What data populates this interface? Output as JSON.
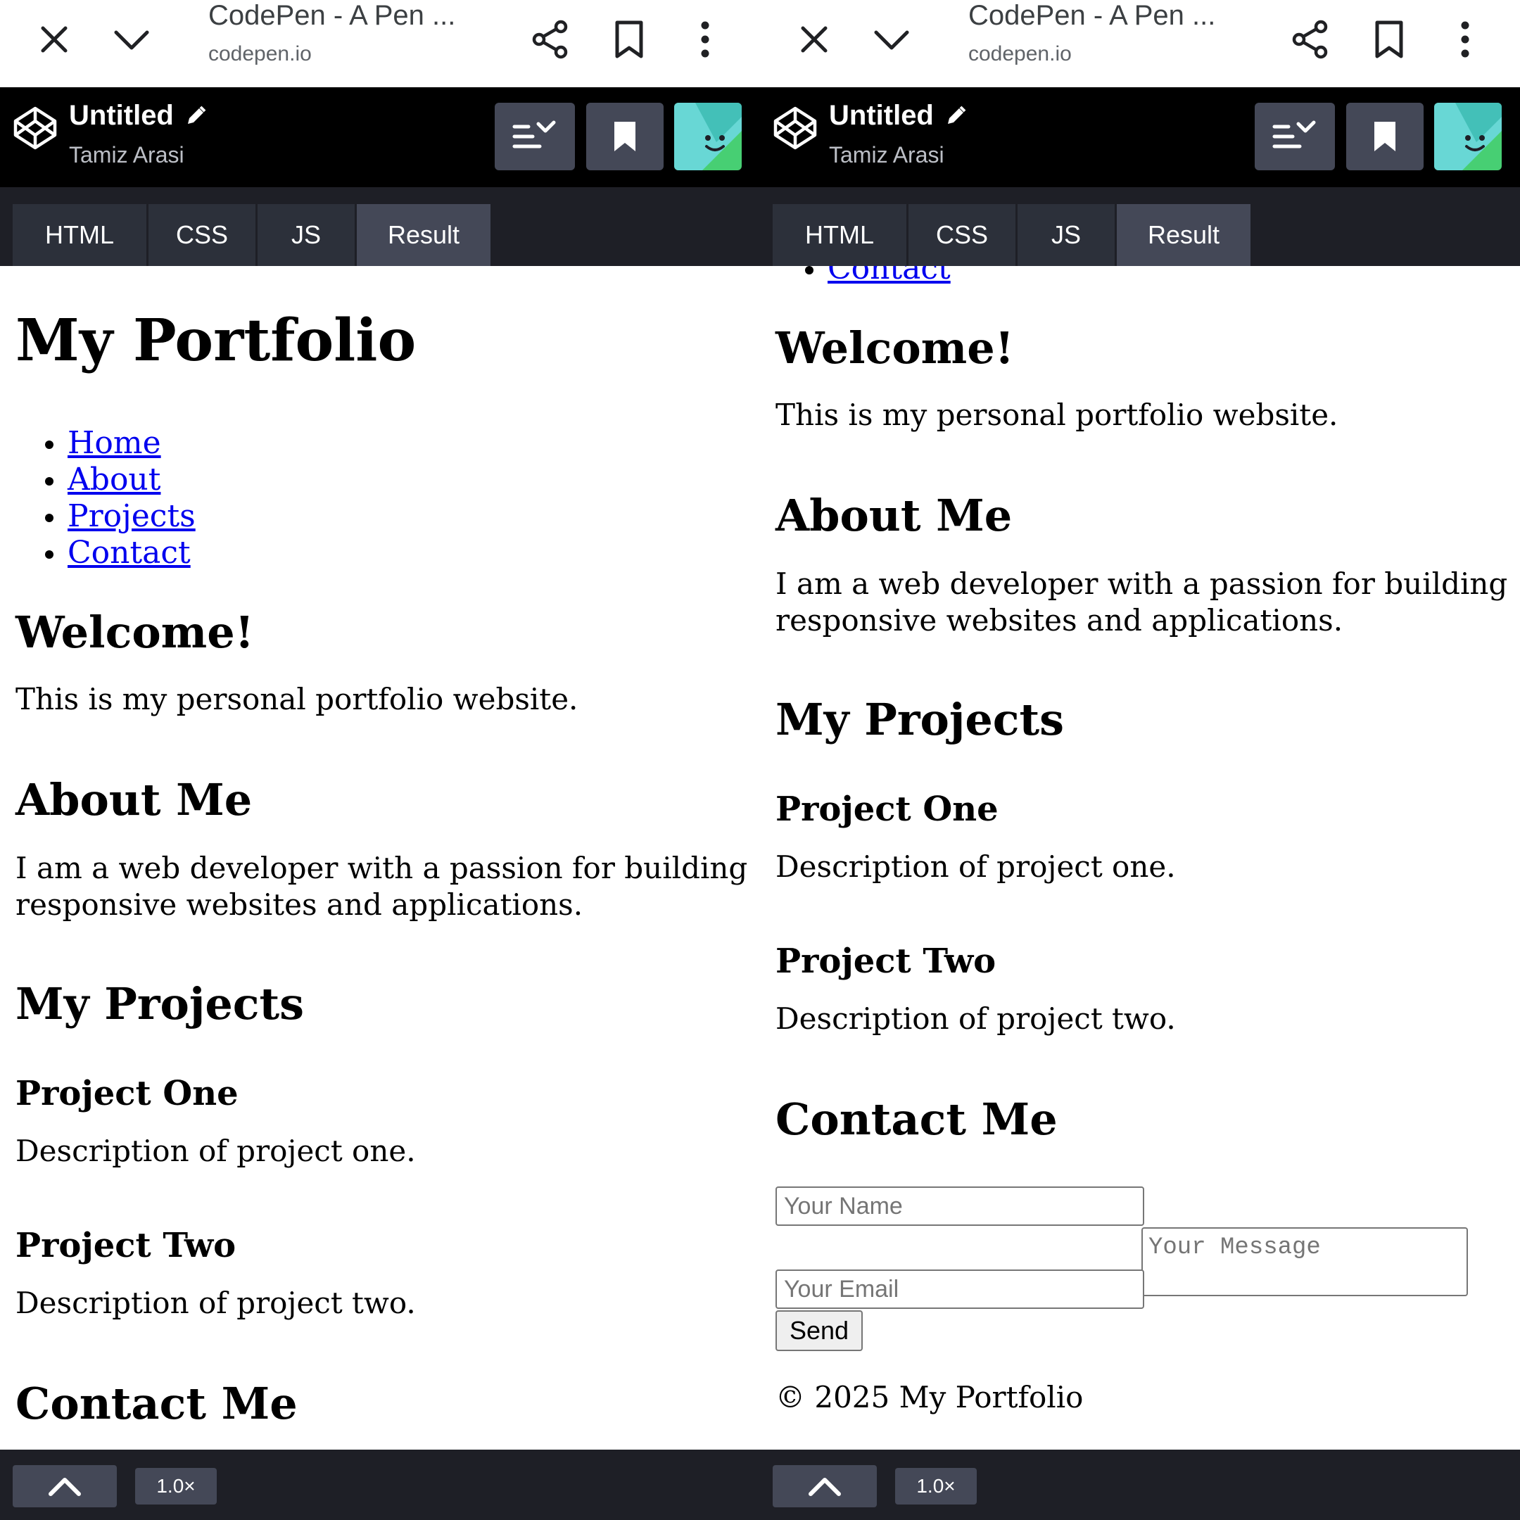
{
  "browser": {
    "title": "CodePen - A Pen ...",
    "url": "codepen.io",
    "icons": [
      "close-icon",
      "chevron-down-icon",
      "share-icon",
      "bookmark-icon",
      "more-vert-icon"
    ]
  },
  "codepen": {
    "pen_title": "Untitled",
    "author": "Tamiz Arasi",
    "tabs": [
      "HTML",
      "CSS",
      "JS",
      "Result"
    ],
    "active_tab": "Result",
    "zoom": "1.0×",
    "colors": {
      "header_bg": "#000000",
      "toolbar_bg": "#1e1f26",
      "button_bg": "#444857",
      "tab_bg": "#2c303a",
      "avatar_accent": "#47cf73"
    }
  },
  "page": {
    "title": "My Portfolio",
    "nav": [
      "Home",
      "About",
      "Projects",
      "Contact"
    ],
    "welcome": {
      "heading": "Welcome!",
      "text": "This is my personal portfolio website."
    },
    "about": {
      "heading": "About Me",
      "line1": "I am a web developer with a passion for building",
      "line2": "responsive websites and applications."
    },
    "projects": {
      "heading": "My Projects",
      "items": [
        {
          "title": "Project One",
          "description": "Description of project one."
        },
        {
          "title": "Project Two",
          "description": "Description of project two."
        }
      ]
    },
    "contact": {
      "heading": "Contact Me",
      "name_placeholder": "Your Name",
      "email_placeholder": "Your Email",
      "message_placeholder": "Your Message",
      "send_label": "Send"
    },
    "footer": "© 2025 My Portfolio",
    "link_color": "#0000ee"
  }
}
